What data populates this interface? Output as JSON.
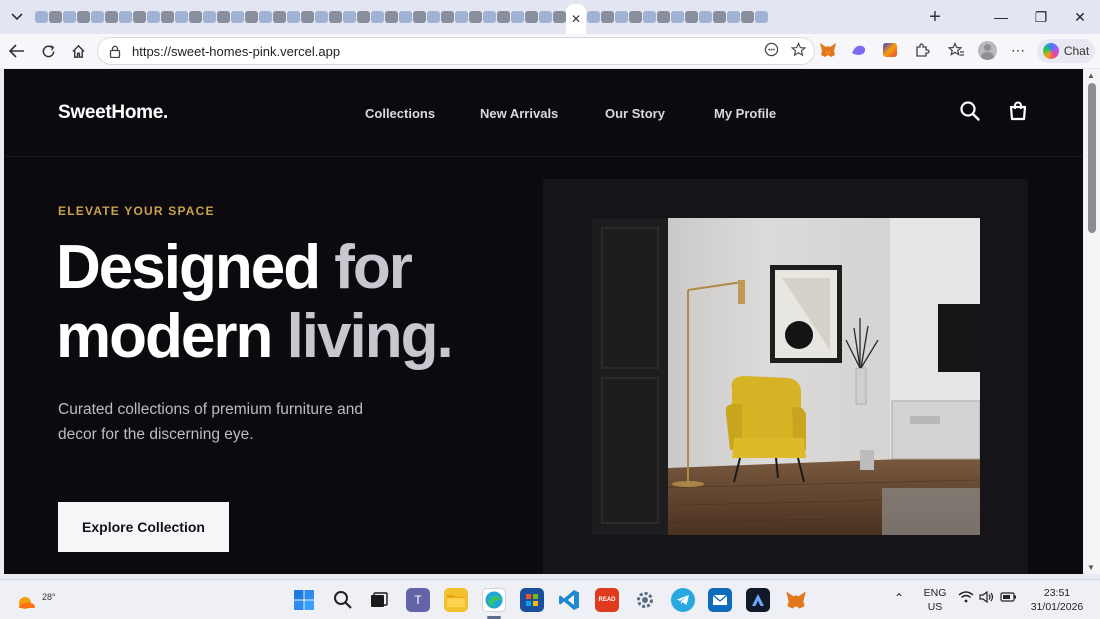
{
  "browser": {
    "active_tab_close": "✕",
    "new_tab": "+",
    "url": "https://sweet-homes-pink.vercel.app",
    "chat_label": "Chat",
    "window": {
      "minimize": "—",
      "restore": "❐",
      "close": "✕"
    }
  },
  "site": {
    "logo": "SweetHome.",
    "nav": [
      "Collections",
      "New Arrivals",
      "Our Story",
      "My Profile"
    ],
    "hero": {
      "eyebrow": "ELEVATE YOUR SPACE",
      "headline_line1_a": "Designed for",
      "headline_line2_a": "modern living.",
      "subtext": "Curated collections of premium furniture and decor for the discerning eye.",
      "cta": "Explore Collection"
    },
    "header_icons": [
      "search-icon",
      "shopping-bag-icon"
    ]
  },
  "taskbar": {
    "weather_temp": "28°",
    "lang_line1": "ENG",
    "lang_line2": "US",
    "time": "23:51",
    "date": "31/01/2026"
  },
  "colors": {
    "page_bg": "#0c0a0e",
    "accent_gold": "#c9a24b",
    "cta_bg": "#f6f5f7",
    "chair_yellow": "#d4b022"
  }
}
